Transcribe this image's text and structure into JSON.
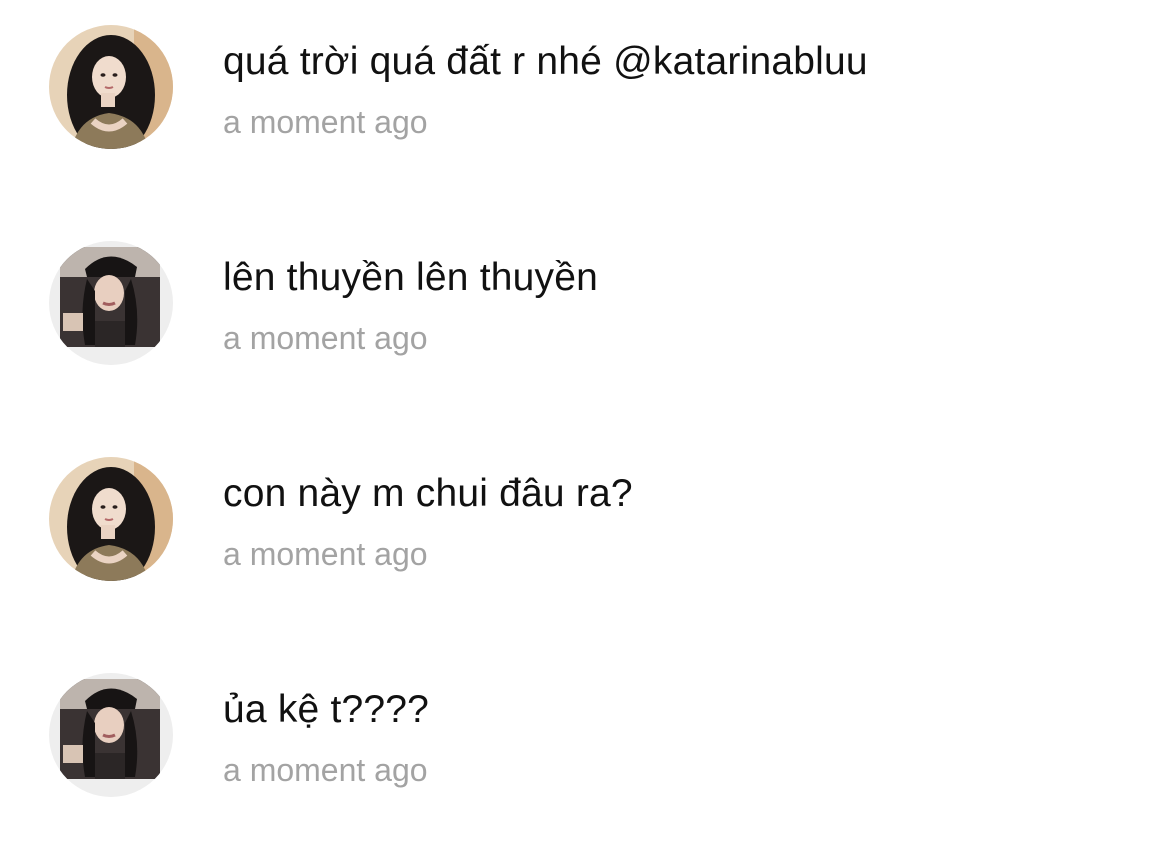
{
  "comments": [
    {
      "avatar_icon": "avatar-user-a",
      "text": "quá trời quá đất r nhé @katarinabluu",
      "time": "a moment ago"
    },
    {
      "avatar_icon": "avatar-user-b",
      "text": "lên thuyền lên thuyền",
      "time": "a moment ago"
    },
    {
      "avatar_icon": "avatar-user-a",
      "text": "con này m chui đâu ra?",
      "time": "a moment ago"
    },
    {
      "avatar_icon": "avatar-user-b",
      "text": "ủa kệ t????",
      "time": "a moment ago"
    }
  ],
  "colors": {
    "text": "#111111",
    "timestamp": "#a3a3a3",
    "background": "#ffffff"
  }
}
